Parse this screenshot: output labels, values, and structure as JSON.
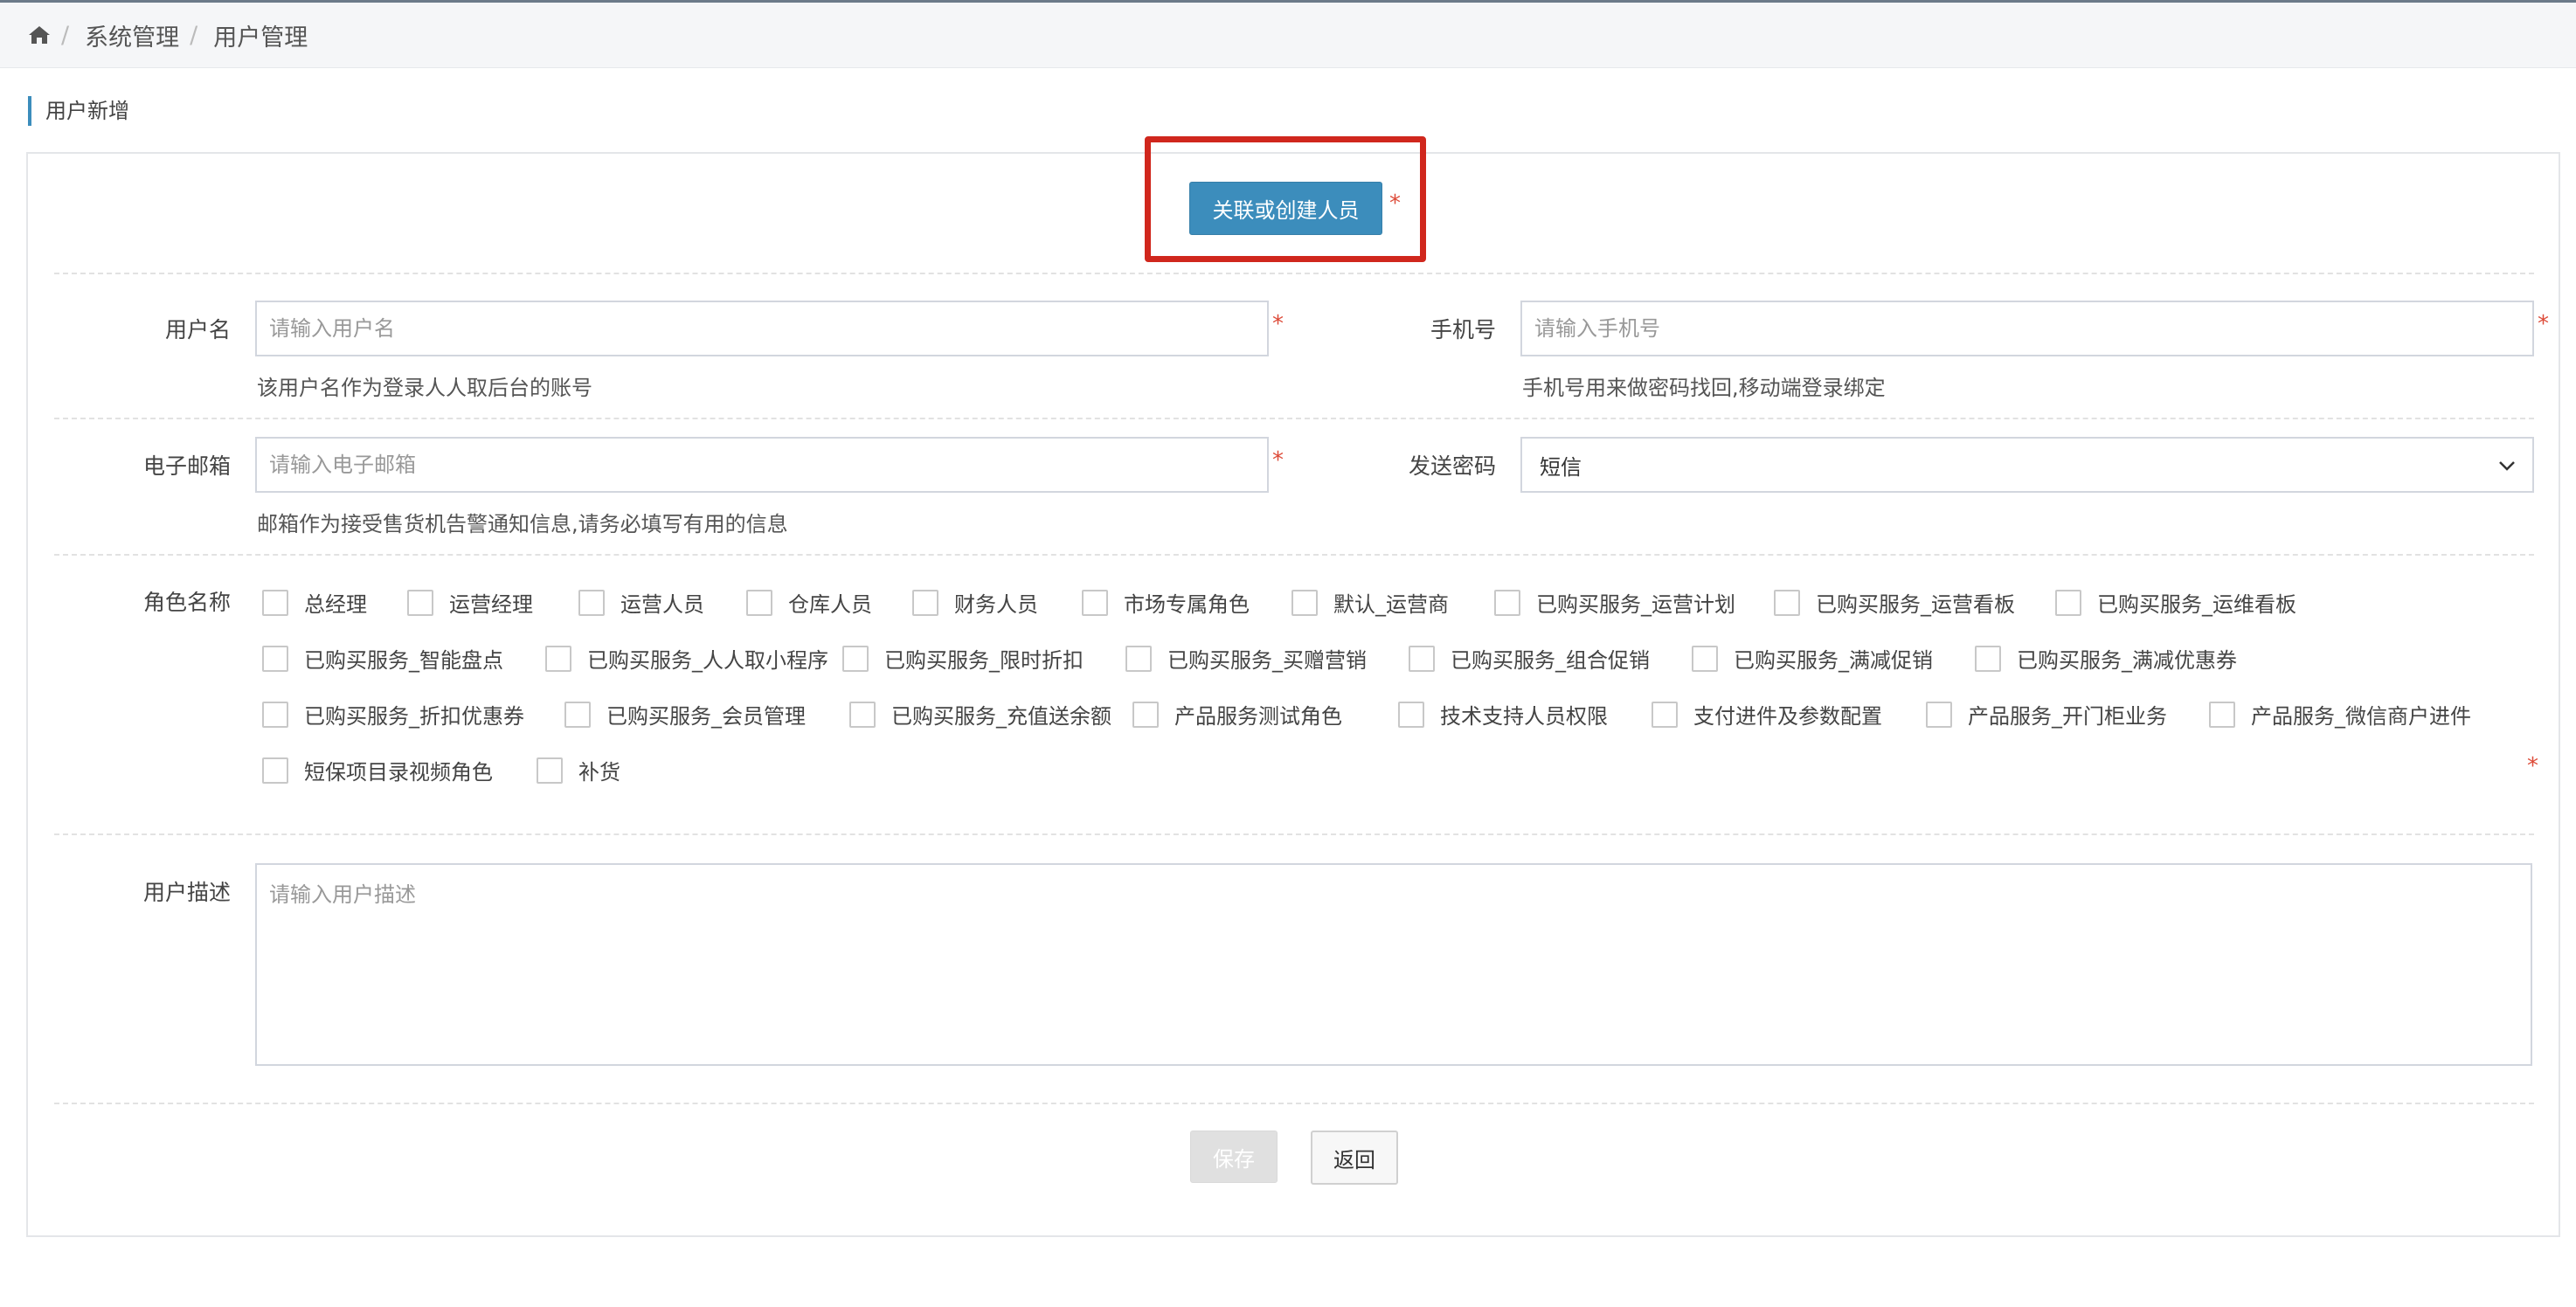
{
  "breadcrumb": {
    "items": [
      "系统管理",
      "用户管理"
    ]
  },
  "section": {
    "title": "用户新增"
  },
  "link_button": {
    "label": "关联或创建人员",
    "required_mark": "*"
  },
  "form": {
    "username": {
      "label": "用户名",
      "placeholder": "请输入用户名",
      "value": "",
      "required_mark": "*",
      "help": "该用户名作为登录人人取后台的账号"
    },
    "phone": {
      "label": "手机号",
      "placeholder": "请输入手机号",
      "value": "",
      "required_mark": "*",
      "help": "手机号用来做密码找回,移动端登录绑定"
    },
    "email": {
      "label": "电子邮箱",
      "placeholder": "请输入电子邮箱",
      "value": "",
      "required_mark": "*",
      "help": "邮箱作为接受售货机告警通知信息,请务必填写有用的信息"
    },
    "send_password": {
      "label": "发送密码",
      "selected": "短信"
    },
    "roles": {
      "label": "角色名称",
      "required_mark": "*",
      "rows": [
        [
          "总经理",
          "运营经理",
          "运营人员",
          "仓库人员",
          "财务人员",
          "市场专属角色",
          "默认_运营商",
          "已购买服务_运营计划",
          "已购买服务_运营看板",
          "已购买服务_运维看板"
        ],
        [
          "已购买服务_智能盘点",
          "已购买服务_人人取小程序",
          "已购买服务_限时折扣",
          "已购买服务_买赠营销",
          "已购买服务_组合促销",
          "已购买服务_满减促销",
          "已购买服务_满减优惠券"
        ],
        [
          "已购买服务_折扣优惠券",
          "已购买服务_会员管理",
          "已购买服务_充值送余额",
          "产品服务测试角色",
          "技术支持人员权限",
          "支付进件及参数配置",
          "产品服务_开门柜业务",
          "产品服务_微信商户进件"
        ],
        [
          "短保项目录视频角色",
          "补货"
        ]
      ]
    },
    "description": {
      "label": "用户描述",
      "placeholder": "请输入用户描述",
      "value": ""
    }
  },
  "actions": {
    "save_label": "保存",
    "back_label": "返回"
  },
  "colors": {
    "primary": "#3c8dbc",
    "highlight": "#d0271d",
    "required": "#dd4b39"
  }
}
